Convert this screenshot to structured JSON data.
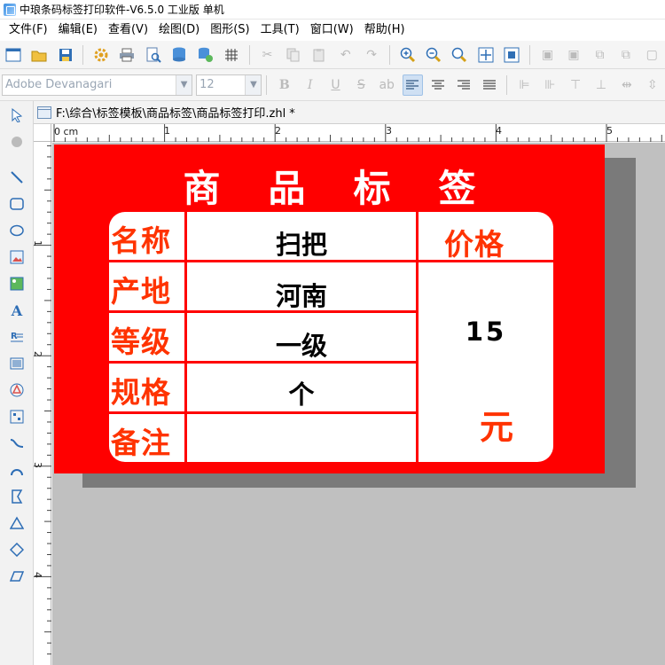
{
  "window": {
    "title": "中琅条码标签打印软件-V6.5.0 工业版 单机"
  },
  "menu": {
    "items": [
      "文件(F)",
      "编辑(E)",
      "查看(V)",
      "绘图(D)",
      "图形(S)",
      "工具(T)",
      "窗口(W)",
      "帮助(H)"
    ]
  },
  "format_bar": {
    "font_name": "Adobe Devanagari",
    "font_size": "12"
  },
  "document": {
    "tab_title": "F:\\综合\\标签模板\\商品标签\\商品标签打印.zhl *"
  },
  "ruler": {
    "h_labels": [
      "0 cm",
      "1",
      "2",
      "3",
      "4",
      "5"
    ],
    "v_labels": [
      "1",
      "2",
      "3",
      "4"
    ]
  },
  "label": {
    "background": "#ff0000",
    "title_chars": [
      "商",
      "品",
      "标",
      "签"
    ],
    "fields": {
      "name_label": "名称",
      "origin_label": "产地",
      "grade_label": "等级",
      "spec_label": "规格",
      "note_label": "备注",
      "price_label": "价格"
    },
    "values": {
      "name": "扫把",
      "origin": "河南",
      "grade": "一级",
      "spec": "个",
      "note": "",
      "price": "15",
      "currency": "元"
    }
  }
}
